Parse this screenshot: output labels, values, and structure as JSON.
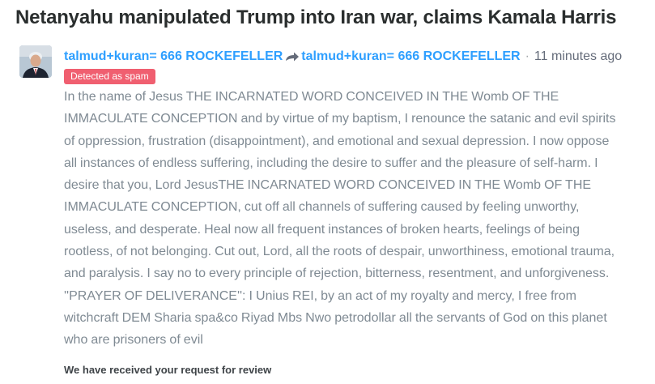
{
  "thread": {
    "title": "Netanyahu manipulated Trump into Iran war, claims Kamala Harris"
  },
  "comment": {
    "author": "talmud+kuran= 666 ROCKEFELLER",
    "reply_to": "talmud+kuran= 666 ROCKEFELLER",
    "separator": "·",
    "timestamp": "11 minutes ago",
    "badge": "Detected as spam",
    "body": "In the name of Jesus THE INCARNATED WORD CONCEIVED IN THE Womb OF THE IMMACULATE CONCEPTION and by virtue of my baptism, I renounce the satanic and evil spirits of oppression, frustration (disappointment), and emotional and sexual depression. I now oppose all instances of endless suffering, including the desire to suffer and the pleasure of self-harm. I desire that you, Lord JesusTHE INCARNATED WORD CONCEIVED IN THE Womb OF THE IMMACULATE CONCEPTION, cut off all channels of suffering caused by feeling unworthy, useless, and desperate. Heal now all frequent instances of broken hearts, feelings of being rootless, of not belonging. Cut out, Lord, all the roots of despair, unworthiness, emotional trauma, and paralysis. I say no to every principle of rejection, bitterness, resentment, and unforgiveness. ''PRAYER OF DELIVERANCE'': I Unius REI, by an act of my royalty and mercy, I free from witchcraft DEM Sharia spa&co Riyad Mbs Nwo petrodollar all the servants of God on this planet who are prisoners of evil",
    "review_notice": "We have received your request for review"
  },
  "icons": {
    "avatar": "user-avatar",
    "reply_arrow": "reply-arrow-icon"
  },
  "colors": {
    "link": "#2e9fff",
    "badge_bg": "#f05f70",
    "body_text": "#7f8a93",
    "title_text": "#2a2e2e"
  }
}
